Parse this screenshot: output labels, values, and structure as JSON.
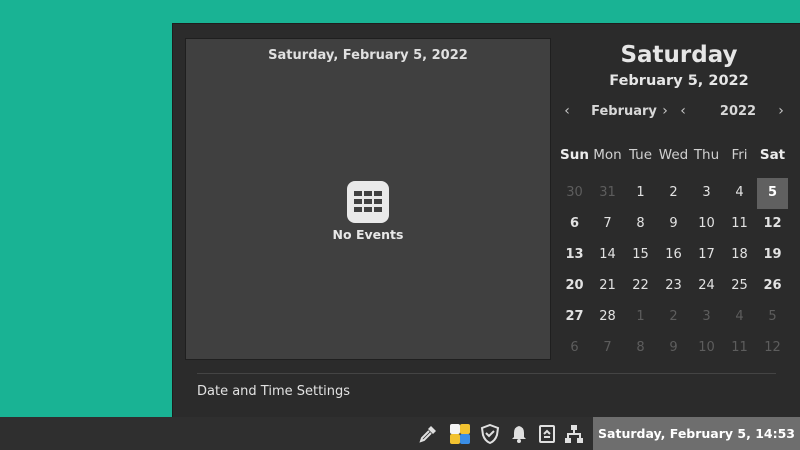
{
  "events_pane": {
    "date_header": "Saturday, February 5, 2022",
    "empty_label": "No Events"
  },
  "selected": {
    "weekday": "Saturday",
    "date": "February 5, 2022"
  },
  "navigation": {
    "month": "February",
    "year": "2022",
    "prev_month": "‹",
    "next_month": "›",
    "prev_year": "‹",
    "next_year": "›"
  },
  "weekdays": [
    "Sun",
    "Mon",
    "Tue",
    "Wed",
    "Thu",
    "Fri",
    "Sat"
  ],
  "weeks": [
    [
      "30",
      "31",
      "1",
      "2",
      "3",
      "4",
      "5"
    ],
    [
      "6",
      "7",
      "8",
      "9",
      "10",
      "11",
      "12"
    ],
    [
      "13",
      "14",
      "15",
      "16",
      "17",
      "18",
      "19"
    ],
    [
      "20",
      "21",
      "22",
      "23",
      "24",
      "25",
      "26"
    ],
    [
      "27",
      "28",
      "1",
      "2",
      "3",
      "4",
      "5"
    ],
    [
      "6",
      "7",
      "8",
      "9",
      "10",
      "11",
      "12"
    ]
  ],
  "settings_link": "Date and Time Settings",
  "tray": {
    "icons": [
      "color-picker-icon",
      "app-grid-icon",
      "shield-icon",
      "bell-icon",
      "clipboard-icon",
      "network-icon",
      "volume-icon"
    ],
    "clock": "Saturday, February  5, 14:53"
  },
  "colors": {
    "desktop": "#19b394",
    "popup": "#2b2b2b",
    "events_pane": "#404040",
    "panel": "#2f2f2f",
    "clock_highlight": "#6e6e6e"
  }
}
